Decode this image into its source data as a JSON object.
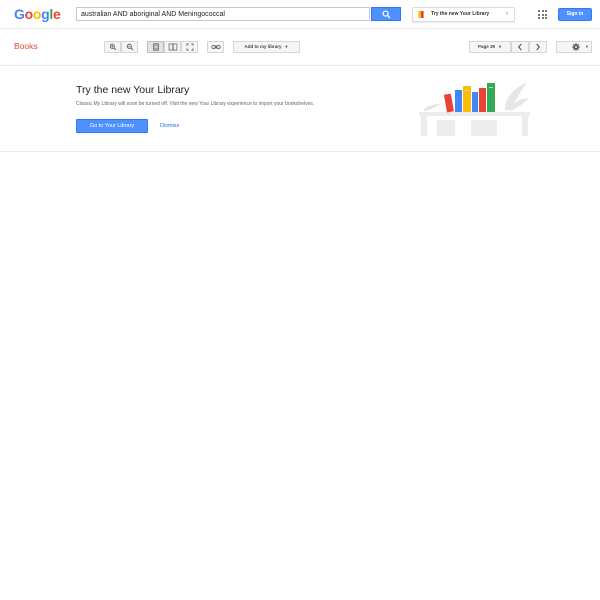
{
  "header": {
    "logo_letters": [
      {
        "char": "G",
        "color": "#4285f4"
      },
      {
        "char": "o",
        "color": "#ea4335"
      },
      {
        "char": "o",
        "color": "#fbbc05"
      },
      {
        "char": "g",
        "color": "#4285f4"
      },
      {
        "char": "l",
        "color": "#34a853"
      },
      {
        "char": "e",
        "color": "#ea4335"
      }
    ],
    "search_value": "australian AND aboriginal AND Meningococcal",
    "promo_button_label": "Try the new Your Library",
    "signin_label": "Sign in",
    "accent_color": "#4d90fe"
  },
  "toolbar": {
    "books_label": "Books",
    "add_to_library_label": "Add to my library",
    "page_label": "Page 39",
    "books_color": "#dd4b39"
  },
  "promo": {
    "heading": "Try the new Your Library",
    "body": "Classic My Library will soon be turned off. Visit the new Your Library experience to import your bookshelves.",
    "go_button_label": "Go to Your Library",
    "dismiss_label": "Dismiss"
  }
}
